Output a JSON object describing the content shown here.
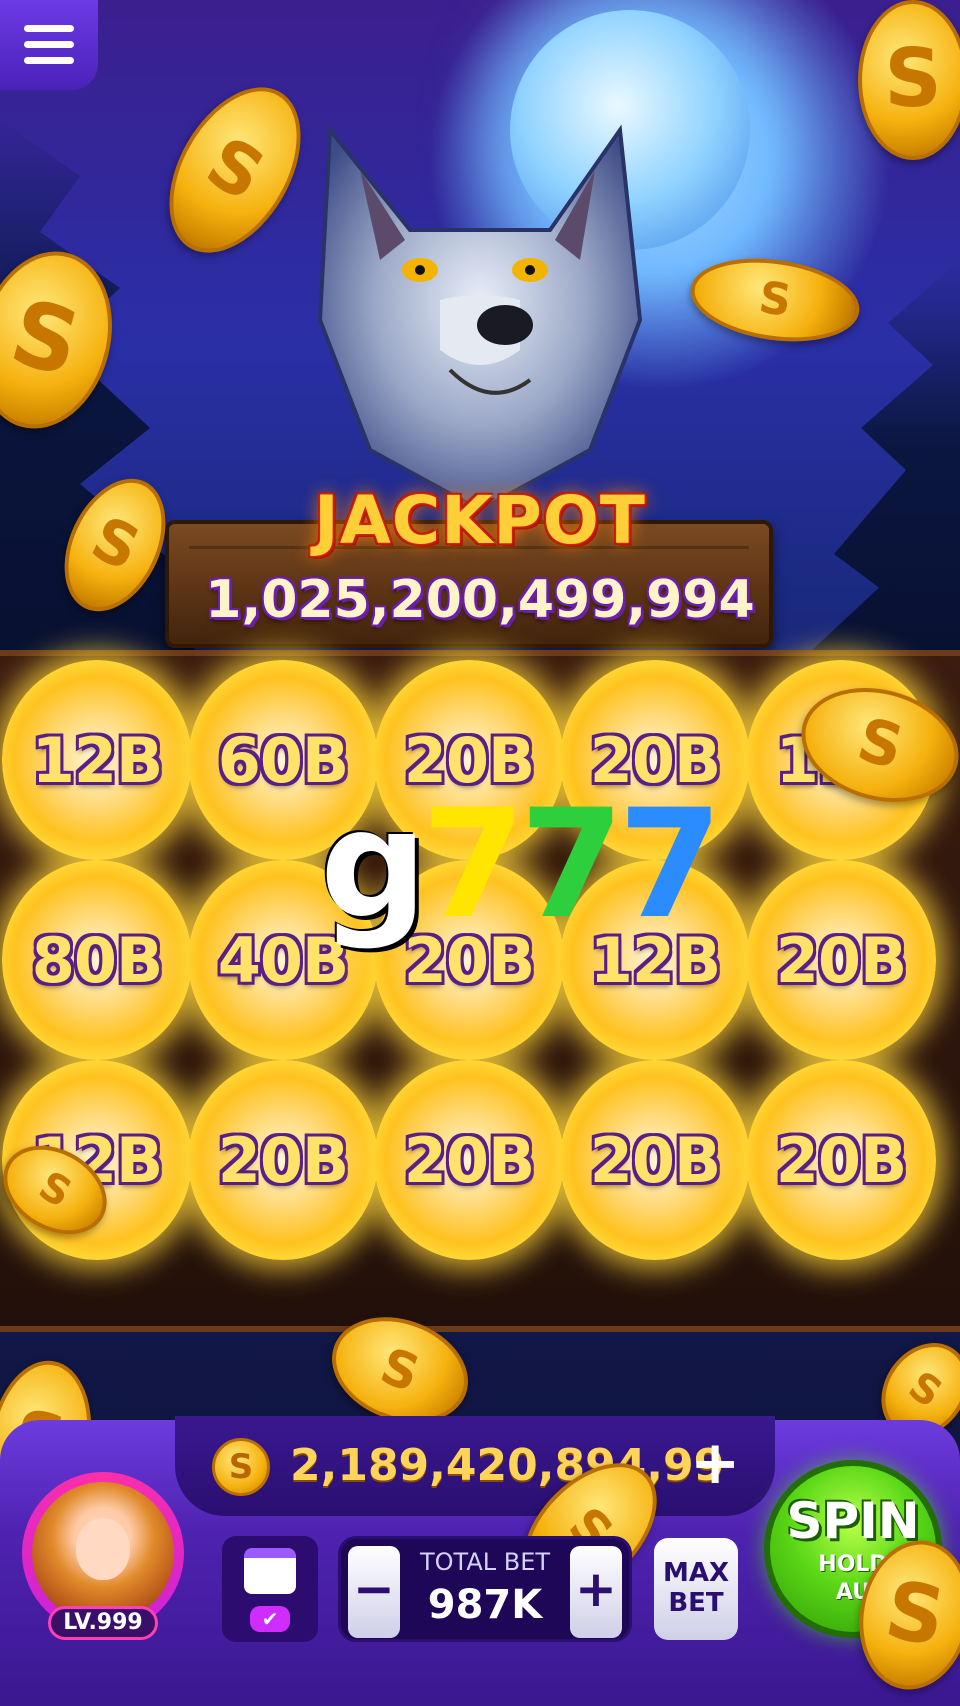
{
  "jackpot": {
    "title": "JACKPOT",
    "amount": "1,025,200,499,994"
  },
  "grid": {
    "rows": [
      [
        "12B",
        "60B",
        "20B",
        "20B",
        "12B"
      ],
      [
        "80B",
        "40B",
        "20B",
        "12B",
        "20B"
      ],
      [
        "12B",
        "20B",
        "20B",
        "20B",
        "20B"
      ]
    ]
  },
  "watermark": {
    "g": "g",
    "d1": "7",
    "d2": "7",
    "d3": "7"
  },
  "balance": {
    "coin_symbol": "S",
    "amount": "2,189,420,894,99",
    "add_label": "+"
  },
  "player": {
    "level": "LV.999"
  },
  "calendar": {
    "check": "✔"
  },
  "bet": {
    "label": "TOTAL BET",
    "value": "987K",
    "minus": "−",
    "plus": "+"
  },
  "max_bet": {
    "line1": "MAX",
    "line2": "BET"
  },
  "spin": {
    "label": "SPIN",
    "sub1": "HOLD",
    "sub2": "AU"
  },
  "icons": {
    "menu": "hamburger-menu-icon",
    "coin": "coin-icon",
    "calendar": "calendar-check-icon"
  },
  "colors": {
    "accent_purple": "#6d3bde",
    "gold": "#ffd45a",
    "spin_green": "#5bd817"
  }
}
